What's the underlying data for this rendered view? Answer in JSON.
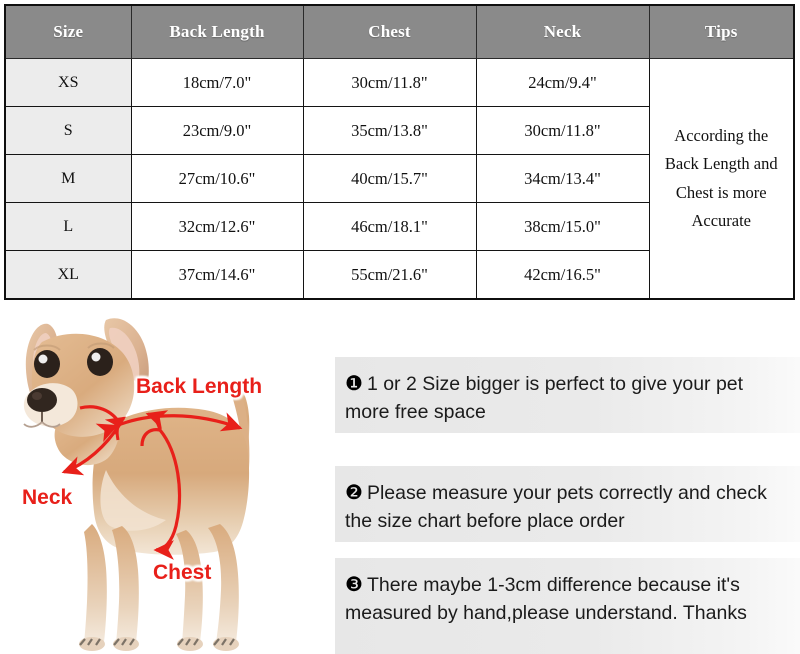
{
  "size_chart": {
    "headers": [
      "Size",
      "Back Length",
      "Chest",
      "Neck",
      "Tips"
    ],
    "rows": [
      {
        "size": "XS",
        "back_length": "18cm/7.0\"",
        "chest": "30cm/11.8\"",
        "neck": "24cm/9.4\""
      },
      {
        "size": "S",
        "back_length": "23cm/9.0\"",
        "chest": "35cm/13.8\"",
        "neck": "30cm/11.8\""
      },
      {
        "size": "M",
        "back_length": "27cm/10.6\"",
        "chest": "40cm/15.7\"",
        "neck": "34cm/13.4\""
      },
      {
        "size": "L",
        "back_length": "32cm/12.6\"",
        "chest": "46cm/18.1\"",
        "neck": "38cm/15.0\""
      },
      {
        "size": "XL",
        "back_length": "37cm/14.6\"",
        "chest": "55cm/21.6\"",
        "neck": "42cm/16.5\""
      }
    ],
    "tips_cell": "According the Back Length and Chest is more Accurate",
    "header_bg": "#8a8a8a",
    "size_column_bg": "#ececec",
    "border_color": "#141414"
  },
  "illustration": {
    "subject": "chihuahua-dog",
    "annotation_color": "#e8201a",
    "labels": {
      "back_length": "Back Length",
      "neck": "Neck",
      "chest": "Chest"
    }
  },
  "tips": [
    {
      "number": "❶",
      "text": "1 or 2 Size bigger is perfect to give your pet more free space"
    },
    {
      "number": "❷",
      "text": "Please measure your pets correctly and check the size chart before place order"
    },
    {
      "number": "❸",
      "text": "There maybe 1-3cm difference because it's measured by hand,please understand. Thanks"
    }
  ]
}
